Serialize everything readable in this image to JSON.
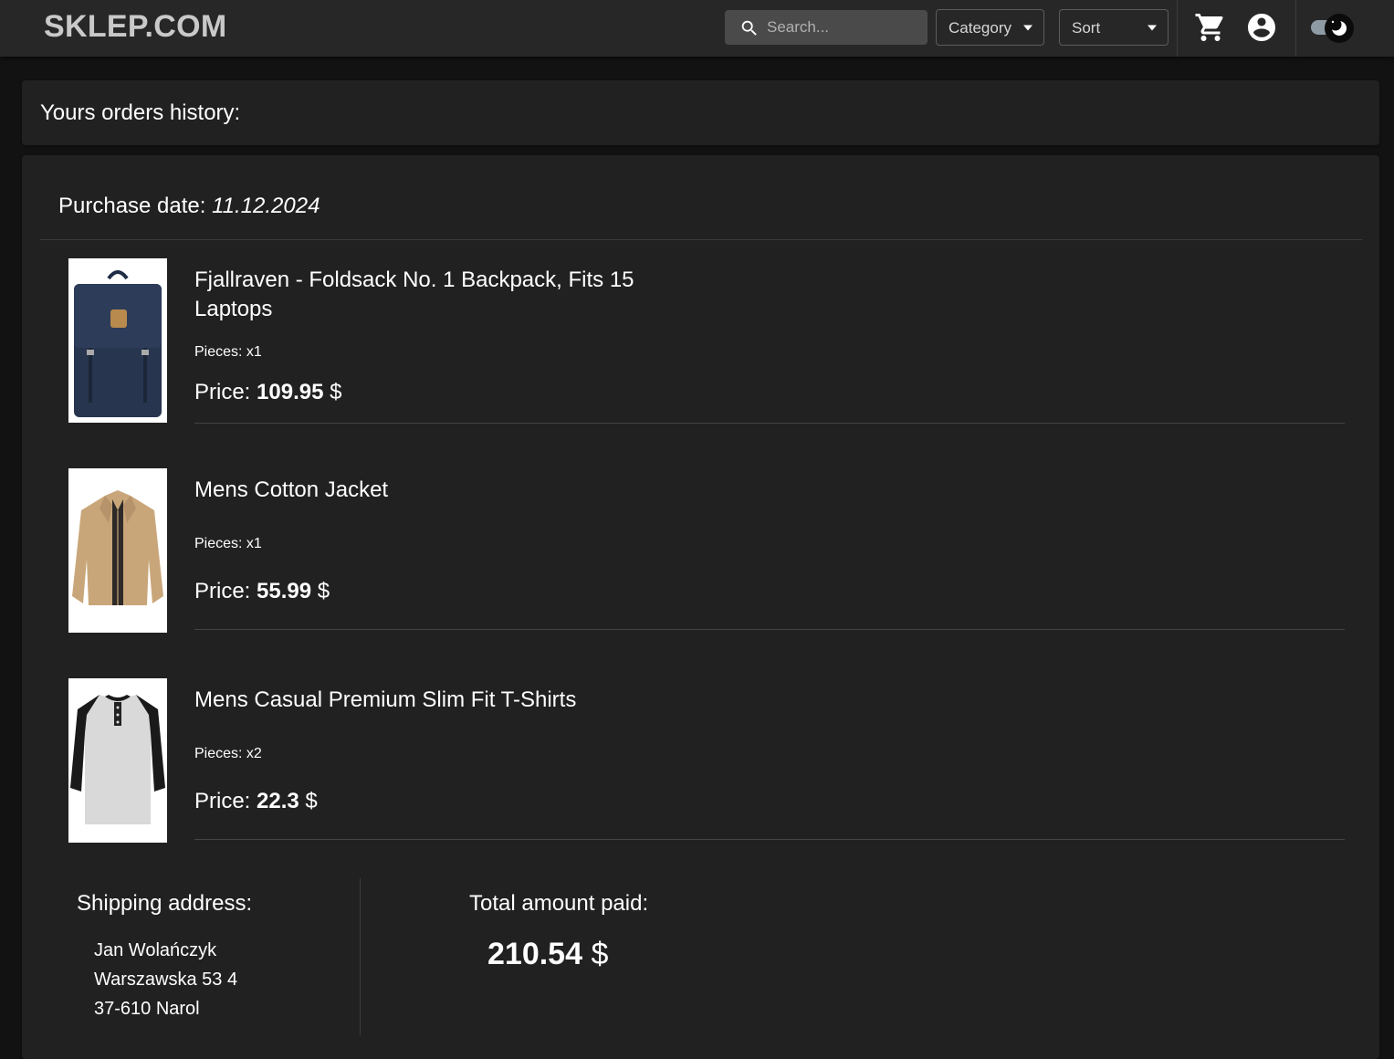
{
  "header": {
    "logo": "SKLEP.COM",
    "search_placeholder": "Search...",
    "category_label": "Category",
    "sort_label": "Sort",
    "icons": [
      "search-icon",
      "cart-icon",
      "account-icon",
      "theme-toggle-icon"
    ]
  },
  "history": {
    "title": "Yours orders history:"
  },
  "order": {
    "purchase_label": "Purchase date:",
    "purchase_date": "11.12.2024",
    "items": [
      {
        "name": "Fjallraven - Foldsack No. 1 Backpack, Fits 15 Laptops",
        "pieces": "Pieces: x1",
        "price_label": "Price:",
        "price": "109.95",
        "currency": "$",
        "image": "navy-backpack"
      },
      {
        "name": "Mens Cotton Jacket",
        "pieces": "Pieces: x1",
        "price_label": "Price:",
        "price": "55.99",
        "currency": "$",
        "image": "tan-jacket"
      },
      {
        "name": "Mens Casual Premium Slim Fit T-Shirts",
        "pieces": "Pieces: x2",
        "price_label": "Price:",
        "price": "22.3",
        "currency": "$",
        "image": "raglan-tshirt"
      }
    ],
    "shipping": {
      "title": "Shipping address:",
      "name": "Jan Wolańczyk",
      "street": "Warszawska 53 4",
      "city": "37-610 Narol"
    },
    "total": {
      "title": "Total amount paid:",
      "amount": "210.54",
      "currency": "$"
    }
  },
  "colors": {
    "background": "#121212",
    "header": "#272727",
    "panel": "#212121",
    "text": "#ffffff"
  }
}
